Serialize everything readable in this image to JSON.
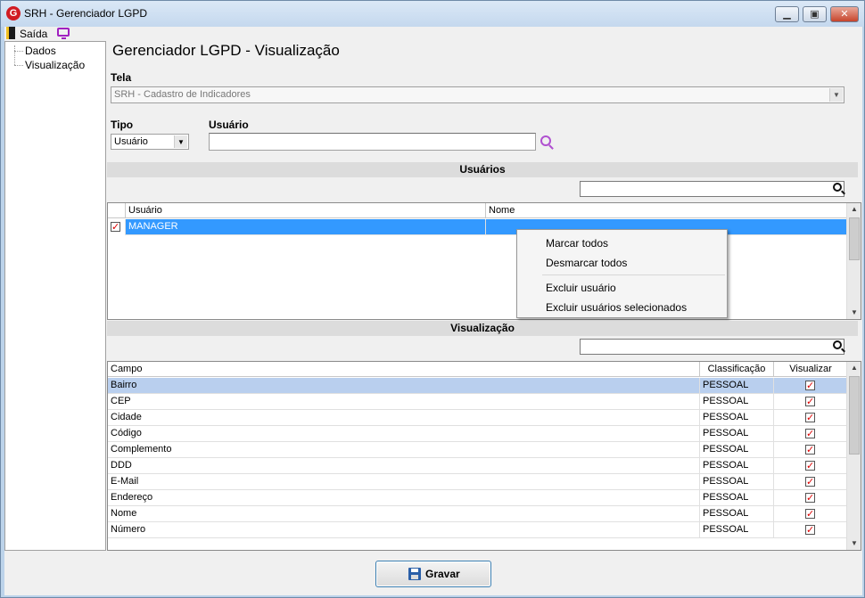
{
  "window": {
    "title": "SRH - Gerenciador LGPD",
    "app_icon_letter": "G",
    "minimize_glyph": "▁",
    "maximize_glyph": "▣",
    "close_glyph": "✕"
  },
  "menubar": {
    "exit_label": "Saída"
  },
  "tree": {
    "items": [
      {
        "label": "Dados"
      },
      {
        "label": "Visualização"
      }
    ]
  },
  "page": {
    "title": "Gerenciador LGPD - Visualização",
    "tela_label": "Tela",
    "tela_value": "SRH - Cadastro de Indicadores",
    "tipo_label": "Tipo",
    "tipo_value": "Usuário",
    "usuario_label": "Usuário",
    "usuario_value": ""
  },
  "usuarios": {
    "section_title": "Usuários",
    "search_value": "",
    "columns": {
      "usuario": "Usuário",
      "nome": "Nome"
    },
    "rows": [
      {
        "checked": true,
        "usuario": "MANAGER",
        "nome": ""
      }
    ]
  },
  "context_menu": {
    "items": [
      {
        "label": "Marcar todos"
      },
      {
        "label": "Desmarcar todos"
      },
      {
        "label": "Excluir usuário"
      },
      {
        "label": "Excluir usuários selecionados"
      }
    ]
  },
  "visualizacao": {
    "section_title": "Visualização",
    "search_value": "",
    "columns": {
      "campo": "Campo",
      "classificacao": "Classificação",
      "visualizar": "Visualizar"
    },
    "rows": [
      {
        "campo": "Bairro",
        "classificacao": "PESSOAL",
        "visualizar": true
      },
      {
        "campo": "CEP",
        "classificacao": "PESSOAL",
        "visualizar": true
      },
      {
        "campo": "Cidade",
        "classificacao": "PESSOAL",
        "visualizar": true
      },
      {
        "campo": "Código",
        "classificacao": "PESSOAL",
        "visualizar": true
      },
      {
        "campo": "Complemento",
        "classificacao": "PESSOAL",
        "visualizar": true
      },
      {
        "campo": "DDD",
        "classificacao": "PESSOAL",
        "visualizar": true
      },
      {
        "campo": "E-Mail",
        "classificacao": "PESSOAL",
        "visualizar": true
      },
      {
        "campo": "Endereço",
        "classificacao": "PESSOAL",
        "visualizar": true
      },
      {
        "campo": "Nome",
        "classificacao": "PESSOAL",
        "visualizar": true
      },
      {
        "campo": "Número",
        "classificacao": "PESSOAL",
        "visualizar": true
      }
    ]
  },
  "footer": {
    "save_label": "Gravar"
  },
  "colors": {
    "selection_blue": "#3399ff",
    "row_selected": "#b9cfee",
    "search_icon_purple": "#b050d0",
    "check_red": "#d00000"
  }
}
